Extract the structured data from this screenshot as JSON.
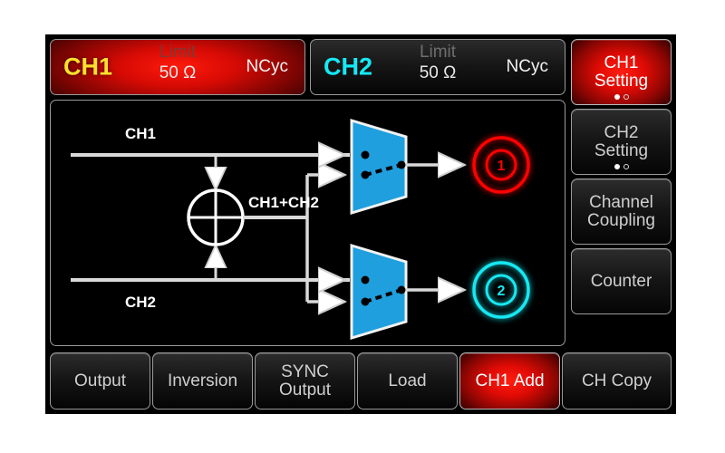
{
  "header": {
    "channels": [
      {
        "name": "CH1",
        "limit_label": "Limit",
        "impedance": "50 Ω",
        "mode": "NCyc",
        "active": true,
        "accent": "#ffe02e"
      },
      {
        "name": "CH2",
        "limit_label": "Limit",
        "impedance": "50 Ω",
        "mode": "NCyc",
        "active": false,
        "accent": "#16e9f5"
      }
    ]
  },
  "diagram": {
    "ch1_label": "CH1",
    "ch2_label": "CH2",
    "sum_label": "CH1+CH2",
    "output1_label": "1",
    "output2_label": "2",
    "output1_color": "#ff0000",
    "output2_color": "#13e8f2",
    "mux_color": "#1f9fdd"
  },
  "sidebar": {
    "items": [
      {
        "line1": "CH1",
        "line2": "Setting",
        "active": true,
        "dots": [
          true,
          false
        ]
      },
      {
        "line1": "CH2",
        "line2": "Setting",
        "active": false,
        "dots": [
          true,
          false
        ]
      },
      {
        "line1": "Channel",
        "line2": "Coupling",
        "active": false,
        "dots": []
      },
      {
        "line1": "Counter",
        "line2": "",
        "active": false,
        "dots": []
      }
    ]
  },
  "bottom_bar": {
    "items": [
      {
        "line1": "Output",
        "line2": "",
        "active": false
      },
      {
        "line1": "Inversion",
        "line2": "",
        "active": false
      },
      {
        "line1": "SYNC",
        "line2": "Output",
        "active": false
      },
      {
        "line1": "Load",
        "line2": "",
        "active": false
      },
      {
        "line1": "CH1 Add",
        "line2": "",
        "active": true
      },
      {
        "line1": "CH Copy",
        "line2": "",
        "active": false
      }
    ]
  }
}
